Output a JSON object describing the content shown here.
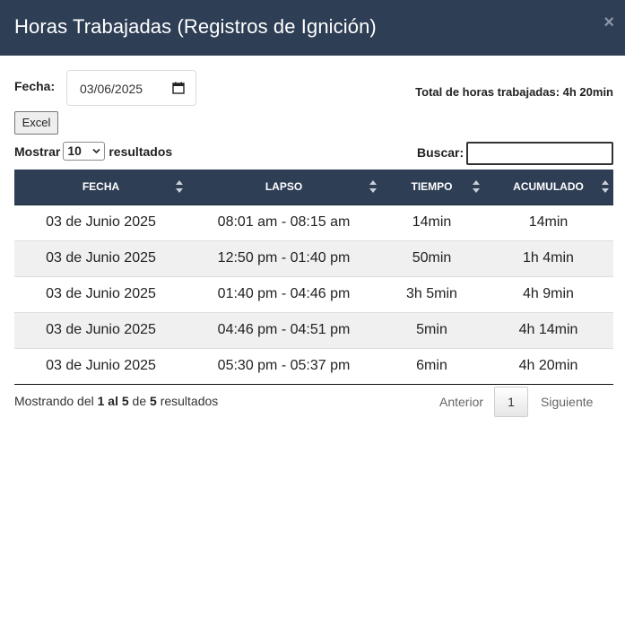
{
  "modal": {
    "title": "Horas Trabajadas (Registros de Ignición)",
    "close_label": "×"
  },
  "filters": {
    "fecha_label": "Fecha:",
    "date_value": "03/06/2025",
    "total_text": "Total de horas trabajadas: 4h 20min",
    "excel_label": "Excel",
    "show_prefix": "Mostrar",
    "page_length": "10",
    "show_suffix": "resultados",
    "search_label": "Buscar:",
    "search_value": ""
  },
  "table": {
    "headers": [
      "FECHA",
      "LAPSO",
      "TIEMPO",
      "ACUMULADO"
    ],
    "rows": [
      [
        "03 de Junio 2025",
        "08:01 am - 08:15 am",
        "14min",
        "14min"
      ],
      [
        "03 de Junio 2025",
        "12:50 pm - 01:40 pm",
        "50min",
        "1h 4min"
      ],
      [
        "03 de Junio 2025",
        "01:40 pm - 04:46 pm",
        "3h 5min",
        "4h 9min"
      ],
      [
        "03 de Junio 2025",
        "04:46 pm - 04:51 pm",
        "5min",
        "4h 14min"
      ],
      [
        "03 de Junio 2025",
        "05:30 pm - 05:37 pm",
        "6min",
        "4h 20min"
      ]
    ]
  },
  "footer": {
    "info_prefix": "Mostrando del",
    "info_range": "1 al 5",
    "info_de": "de",
    "info_total": "5",
    "info_suffix": "resultados",
    "prev_label": "Anterior",
    "current_page": "1",
    "next_label": "Siguiente"
  },
  "colors": {
    "header_bg": "#2e3e55",
    "striped_row": "#f0f0f0"
  },
  "icons": {
    "close": "close-icon",
    "calendar": "calendar-icon",
    "sort": "sort-icon",
    "select": "chevron-down-icon"
  }
}
